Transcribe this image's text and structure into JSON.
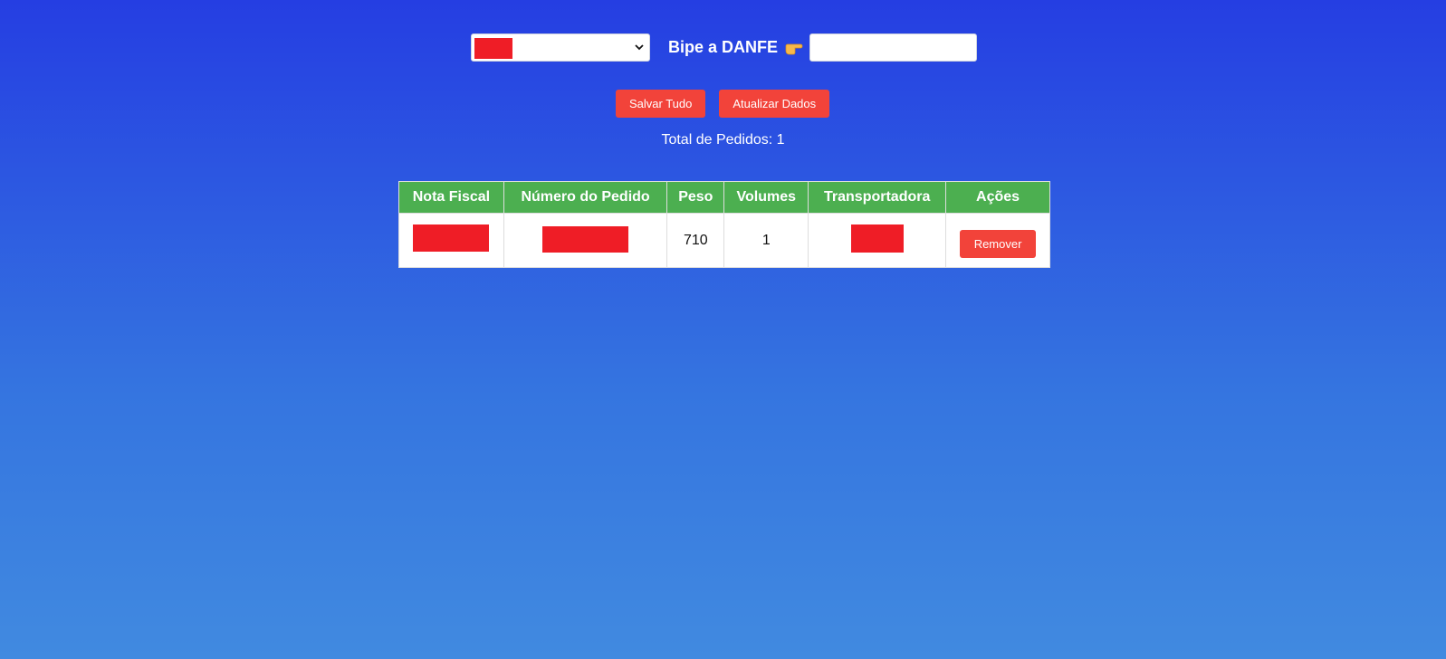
{
  "header": {
    "scan_label": "Bipe a DANFE",
    "pointing_icon": "backhand-index-pointing-right-icon",
    "scan_input_value": "",
    "scan_input_placeholder": ""
  },
  "actions": {
    "save_all_label": "Salvar Tudo",
    "refresh_label": "Atualizar Dados",
    "remove_label": "Remover"
  },
  "summary": {
    "total_text": "Total de Pedidos: 1"
  },
  "table": {
    "headers": [
      "Nota Fiscal",
      "Número do Pedido",
      "Peso",
      "Volumes",
      "Transportadora",
      "Ações"
    ],
    "rows": [
      {
        "nota_fiscal": "",
        "numero_pedido": "",
        "peso": "710",
        "volumes": "1",
        "transportadora": ""
      }
    ]
  },
  "colors": {
    "button": "#f2433a",
    "table_header": "#4caf50",
    "redaction": "#ef1d26",
    "background_top": "#253ee2",
    "background_bottom": "#418ae0"
  }
}
